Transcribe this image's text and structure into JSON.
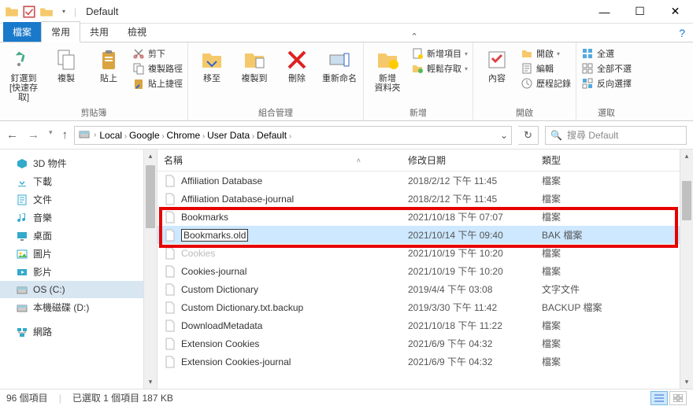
{
  "title": "Default",
  "tabs": {
    "file": "檔案",
    "home": "常用",
    "share": "共用",
    "view": "檢視"
  },
  "ribbon": {
    "clipboard": {
      "pin": "釘選到 [快速存取]",
      "copy": "複製",
      "paste": "貼上",
      "cut": "剪下",
      "copypath": "複製路徑",
      "pasteshortcut": "貼上捷徑",
      "label": "剪貼簿"
    },
    "organize": {
      "moveto": "移至",
      "copyto": "複製到",
      "delete": "刪除",
      "rename": "重新命名",
      "label": "組合管理"
    },
    "new": {
      "newfolder": "新增\n資料夾",
      "newitem": "新增項目",
      "easyaccess": "輕鬆存取",
      "label": "新增"
    },
    "open": {
      "properties": "內容",
      "open": "開啟",
      "edit": "編輯",
      "history": "歷程記錄",
      "label": "開啟"
    },
    "select": {
      "selectall": "全選",
      "selectnone": "全部不選",
      "invert": "反向選擇",
      "label": "選取"
    }
  },
  "breadcrumbs": [
    "Local",
    "Google",
    "Chrome",
    "User Data",
    "Default"
  ],
  "search_placeholder": "搜尋 Default",
  "nav": [
    {
      "label": "3D 物件",
      "icon": "3d"
    },
    {
      "label": "下載",
      "icon": "download"
    },
    {
      "label": "文件",
      "icon": "doc"
    },
    {
      "label": "音樂",
      "icon": "music"
    },
    {
      "label": "桌面",
      "icon": "desktop"
    },
    {
      "label": "圖片",
      "icon": "pic"
    },
    {
      "label": "影片",
      "icon": "video"
    },
    {
      "label": "OS (C:)",
      "icon": "disk",
      "selected": true
    },
    {
      "label": "本機磁碟 (D:)",
      "icon": "disk"
    },
    {
      "label": "網路",
      "icon": "network"
    }
  ],
  "columns": {
    "name": "名稱",
    "date": "修改日期",
    "type": "類型"
  },
  "files": [
    {
      "name": "Affiliation Database",
      "date": "2018/2/12 下午 11:45",
      "type": "檔案"
    },
    {
      "name": "Affiliation Database-journal",
      "date": "2018/2/12 下午 11:45",
      "type": "檔案"
    },
    {
      "name": "Bookmarks",
      "date": "2021/10/18 下午 07:07",
      "type": "檔案",
      "hl": true
    },
    {
      "name": "Bookmarks.old",
      "date": "2021/10/14 下午 09:40",
      "type": "BAK 檔案",
      "hl": true,
      "sel": true,
      "rename": true
    },
    {
      "name": "Cookies",
      "date": "2021/10/19 下午 10:20",
      "type": "檔案",
      "dim": true
    },
    {
      "name": "Cookies-journal",
      "date": "2021/10/19 下午 10:20",
      "type": "檔案"
    },
    {
      "name": "Custom Dictionary",
      "date": "2019/4/4 下午 03:08",
      "type": "文字文件"
    },
    {
      "name": "Custom Dictionary.txt.backup",
      "date": "2019/3/30 下午 11:42",
      "type": "BACKUP 檔案"
    },
    {
      "name": "DownloadMetadata",
      "date": "2021/10/18 下午 11:22",
      "type": "檔案"
    },
    {
      "name": "Extension Cookies",
      "date": "2021/6/9 下午 04:32",
      "type": "檔案"
    },
    {
      "name": "Extension Cookies-journal",
      "date": "2021/6/9 下午 04:32",
      "type": "檔案"
    }
  ],
  "status": {
    "items": "96 個項目",
    "selection": "已選取 1 個項目  187 KB"
  }
}
